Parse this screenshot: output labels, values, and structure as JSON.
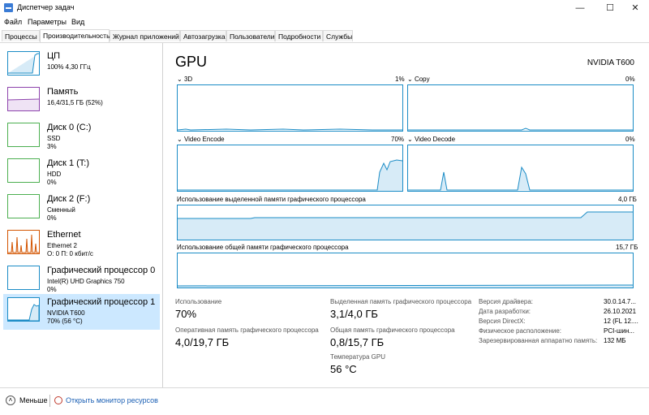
{
  "window": {
    "title": "Диспетчер задач",
    "minimize": "—",
    "maximize": "☐",
    "close": "✕"
  },
  "menu": [
    "Файл",
    "Параметры",
    "Вид"
  ],
  "tabs": [
    "Процессы",
    "Производительность",
    "Журнал приложений",
    "Автозагрузка",
    "Пользователи",
    "Подробности",
    "Службы"
  ],
  "active_tab": "Производительность",
  "sidebar": {
    "items": [
      {
        "title": "ЦП",
        "sub1": "100% 4,30 ГГц",
        "sub2": "",
        "color": "#1b8cc6",
        "selected": false
      },
      {
        "title": "Память",
        "sub1": "16,4/31,5 ГБ (52%)",
        "sub2": "",
        "color": "#8e44ad",
        "selected": false
      },
      {
        "title": "Диск 0 (C:)",
        "sub1": "SSD",
        "sub2": "3%",
        "color": "#4caf50",
        "selected": false
      },
      {
        "title": "Диск 1 (T:)",
        "sub1": "HDD",
        "sub2": "0%",
        "color": "#4caf50",
        "selected": false
      },
      {
        "title": "Диск 2 (F:)",
        "sub1": "Сменный",
        "sub2": "0%",
        "color": "#4caf50",
        "selected": false
      },
      {
        "title": "Ethernet",
        "sub1": "Ethernet 2",
        "sub2": "О: 0 П: 0 кбит/с",
        "color": "#d35400",
        "selected": false
      },
      {
        "title": "Графический процессор 0",
        "sub1": "Intel(R) UHD Graphics 750",
        "sub2": "0%",
        "color": "#1b8cc6",
        "selected": false
      },
      {
        "title": "Графический процессор 1",
        "sub1": "NVIDIA T600",
        "sub2": "70% (56 °C)",
        "color": "#1b8cc6",
        "selected": true
      }
    ]
  },
  "main": {
    "title": "GPU",
    "model": "NVIDIA T600",
    "engines": [
      {
        "name": "3D",
        "value": "1%"
      },
      {
        "name": "Copy",
        "value": "0%"
      },
      {
        "name": "Video Encode",
        "value": "70%"
      },
      {
        "name": "Video Decode",
        "value": "0%"
      }
    ],
    "dedicated_memory": {
      "label": "Использование выделенной памяти графического процессора",
      "max": "4,0 ГБ"
    },
    "shared_memory": {
      "label": "Использование общей памяти графического процессора",
      "max": "15,7 ГБ"
    },
    "stats": {
      "usage_label": "Использование",
      "usage_value": "70%",
      "ded_label": "Выделенная память графического процессора",
      "ded_value": "3,1/4,0 ГБ",
      "ram_label": "Оперативная память графического процессора",
      "ram_value": "4,0/19,7 ГБ",
      "shared_label": "Общая память графического процессора",
      "shared_value": "0,8/15,7 ГБ",
      "temp_label": "Температура GPU",
      "temp_value": "56 °C"
    },
    "info": [
      {
        "label": "Версия драйвера:",
        "value": "30.0.14.7..."
      },
      {
        "label": "Дата разработки:",
        "value": "26.10.2021"
      },
      {
        "label": "Версия DirectX:",
        "value": "12 (FL 12...."
      },
      {
        "label": "Физическое расположение:",
        "value": "PCI-шин..."
      },
      {
        "label": "Зарезервированная аппаратно память:",
        "value": "132 МБ"
      }
    ]
  },
  "footer": {
    "less": "Меньше",
    "monitor": "Открыть монитор ресурсов"
  }
}
